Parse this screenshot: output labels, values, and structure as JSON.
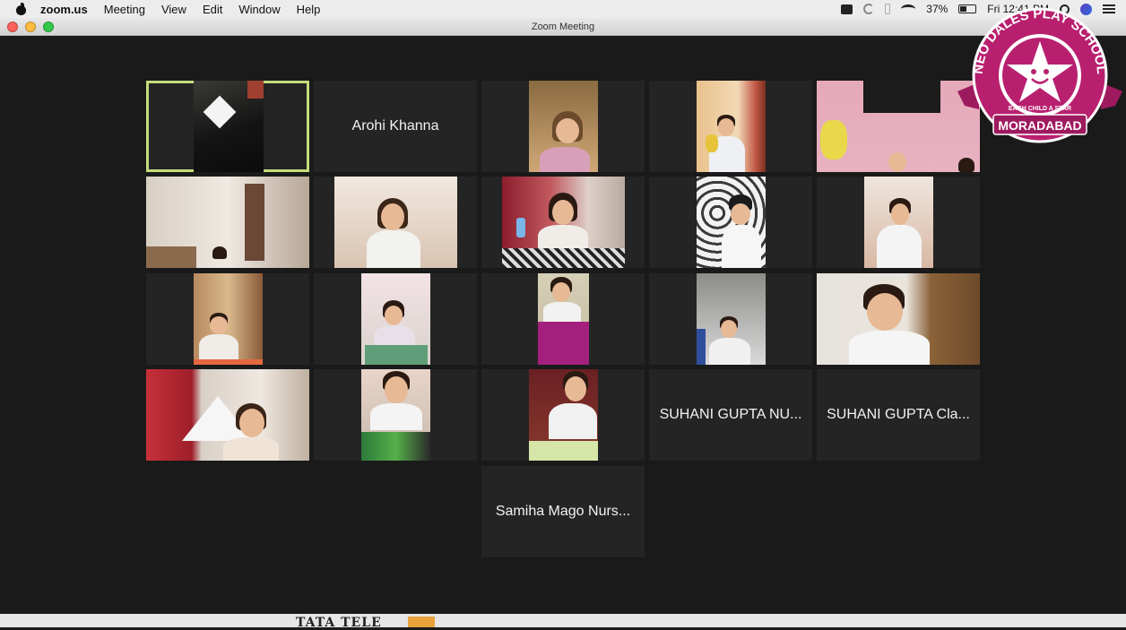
{
  "menubar": {
    "app_name": "zoom.us",
    "menus": [
      "Meeting",
      "View",
      "Edit",
      "Window",
      "Help"
    ],
    "battery_percent": "37%",
    "battery_level": 0.37,
    "clock": "Fri 12:41 PM"
  },
  "window": {
    "title": "Zoom Meeting"
  },
  "participants": [
    {
      "name": "",
      "video": true,
      "active_speaker": true
    },
    {
      "name": "Arohi Khanna",
      "video": false
    },
    {
      "name": "",
      "video": true
    },
    {
      "name": "",
      "video": true
    },
    {
      "name": "",
      "video": true
    },
    {
      "name": "",
      "video": true
    },
    {
      "name": "",
      "video": true
    },
    {
      "name": "",
      "video": true
    },
    {
      "name": "",
      "video": true
    },
    {
      "name": "",
      "video": true
    },
    {
      "name": "",
      "video": true
    },
    {
      "name": "",
      "video": true
    },
    {
      "name": "",
      "video": true
    },
    {
      "name": "",
      "video": true
    },
    {
      "name": "",
      "video": true
    },
    {
      "name": "",
      "video": true
    },
    {
      "name": "",
      "video": true
    },
    {
      "name": "",
      "video": true
    },
    {
      "name": "SUHANI GUPTA NU...",
      "video": false
    },
    {
      "name": "SUHANI GUPTA Cla...",
      "video": false
    },
    {
      "name": "Samiha Mago Nurs...",
      "video": false
    }
  ],
  "badge": {
    "school_name": "NEO DALES PLAY SCHOOL",
    "motto": "EACH CHILD A STAR",
    "city": "MORADABAD",
    "colors": {
      "primary": "#b8206f",
      "ribbon": "#9e1a5f",
      "star": "#ffffff"
    }
  },
  "bottom": {
    "brand_text": "TATA TELE"
  }
}
